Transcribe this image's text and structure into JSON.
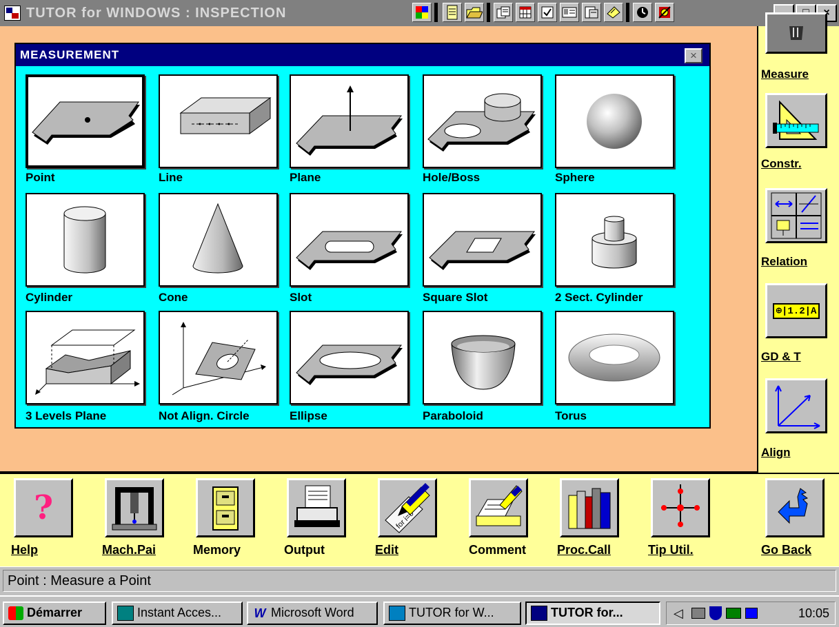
{
  "window": {
    "title": "TUTOR for WINDOWS : INSPECTION",
    "minimize": "_",
    "maximize": "□",
    "close": "×"
  },
  "toolbar_icons": [
    "color-palette-icon",
    "notepad-icon",
    "open-folder-icon",
    "print-preview-icon",
    "grid-icon",
    "checklist-icon",
    "card-icon",
    "report-icon",
    "note-icon",
    "clock-icon",
    "tools-icon"
  ],
  "dialog": {
    "title": "MEASUREMENT",
    "close": "×",
    "items": [
      {
        "label": "Point",
        "icon": "point-icon"
      },
      {
        "label": "Line",
        "icon": "line-icon"
      },
      {
        "label": "Plane",
        "icon": "plane-icon"
      },
      {
        "label": "Hole/Boss",
        "icon": "hole-boss-icon"
      },
      {
        "label": "Sphere",
        "icon": "sphere-icon"
      },
      {
        "label": "Cylinder",
        "icon": "cylinder-icon"
      },
      {
        "label": "Cone",
        "icon": "cone-icon"
      },
      {
        "label": "Slot",
        "icon": "slot-icon"
      },
      {
        "label": "Square Slot",
        "icon": "square-slot-icon"
      },
      {
        "label": "2 Sect. Cylinder",
        "icon": "two-section-cylinder-icon"
      },
      {
        "label": "3 Levels Plane",
        "icon": "three-levels-plane-icon"
      },
      {
        "label": "Not Align. Circle",
        "icon": "not-aligned-circle-icon"
      },
      {
        "label": "Ellipse",
        "icon": "ellipse-icon"
      },
      {
        "label": "Paraboloid",
        "icon": "paraboloid-icon"
      },
      {
        "label": "Torus",
        "icon": "torus-icon"
      }
    ]
  },
  "right_toolbar": [
    {
      "label": "Measure",
      "icon": "measure-icon"
    },
    {
      "label": "Constr.",
      "icon": "construction-icon"
    },
    {
      "label": "Relation",
      "icon": "relation-icon"
    },
    {
      "label": "GD & T",
      "icon": "gdt-icon",
      "icon_text": "⊕|1.2|A"
    },
    {
      "label": "Align",
      "icon": "align-icon"
    }
  ],
  "bottom_toolbar": [
    {
      "label": "Help",
      "icon": "help-icon",
      "glyph": "?"
    },
    {
      "label": "Mach.Pai",
      "icon": "machine-parameters-icon"
    },
    {
      "label": "Memory",
      "icon": "memory-cabinet-icon"
    },
    {
      "label": "Output",
      "icon": "printer-icon"
    },
    {
      "label": "Edit",
      "icon": "edit-pen-icon"
    },
    {
      "label": "Comment",
      "icon": "comment-icon"
    },
    {
      "label": "Proc.Call",
      "icon": "books-icon"
    },
    {
      "label": "Tip Util.",
      "icon": "probe-tip-icon"
    },
    {
      "label": "Go Back",
      "icon": "go-back-arrow-icon"
    }
  ],
  "status": "Point : Measure a Point",
  "taskbar": {
    "start": "Démarrer",
    "tasks": [
      "Instant Acces...",
      "Microsoft Word",
      "TUTOR for W...",
      "TUTOR for..."
    ],
    "clock": "10:05"
  },
  "colors": {
    "workspace": "#fbc08a",
    "toolbar": "#ffff99",
    "dialog_bg": "#00ffff",
    "dialog_title": "#000080",
    "title_bar": "#808080"
  }
}
